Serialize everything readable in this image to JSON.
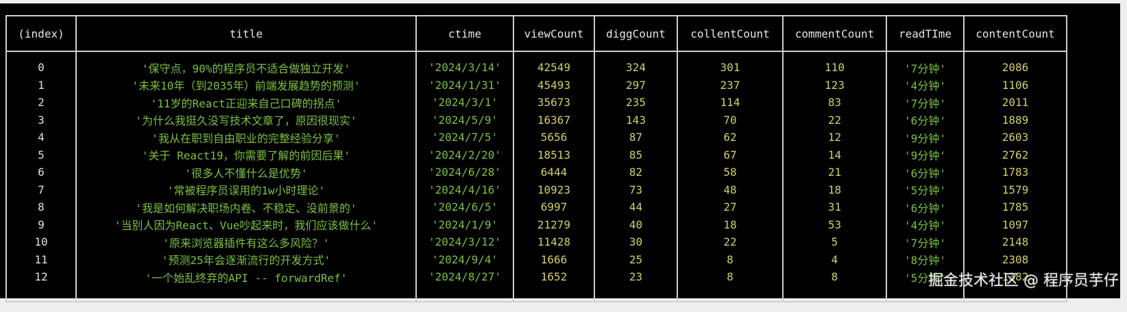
{
  "columns": [
    "(index)",
    "title",
    "ctime",
    "viewCount",
    "diggCount",
    "collentCount",
    "commentCount",
    "readTIme",
    "contentCount"
  ],
  "rows": [
    [
      "0",
      "'保守点，90%的程序员不适合做独立开发'",
      "'2024/3/14'",
      "42549",
      "324",
      "301",
      "110",
      "'7分钟'",
      "2086"
    ],
    [
      "1",
      "'未来10年（到2035年）前端发展趋势的预测'",
      "'2024/1/31'",
      "45493",
      "297",
      "237",
      "123",
      "'4分钟'",
      "1106"
    ],
    [
      "2",
      "'11岁的React正迎来自己口碑的拐点'",
      "'2024/3/1'",
      "35673",
      "235",
      "114",
      "83",
      "'7分钟'",
      "2011"
    ],
    [
      "3",
      "'为什么我挺久没写技术文章了，原因很现实'",
      "'2024/5/9'",
      "16367",
      "143",
      "70",
      "22",
      "'6分钟'",
      "1889"
    ],
    [
      "4",
      "'我从在职到自由职业的完整经验分享'",
      "'2024/7/5'",
      "5656",
      "87",
      "62",
      "12",
      "'9分钟'",
      "2603"
    ],
    [
      "5",
      "'关于 React19，你需要了解的前因后果'",
      "'2024/2/20'",
      "18513",
      "85",
      "67",
      "14",
      "'9分钟'",
      "2762"
    ],
    [
      "6",
      "'很多人不懂什么是优势'",
      "'2024/6/28'",
      "6444",
      "82",
      "58",
      "21",
      "'6分钟'",
      "1783"
    ],
    [
      "7",
      "'常被程序员误用的1w小时理论'",
      "'2024/4/16'",
      "10923",
      "73",
      "48",
      "18",
      "'5分钟'",
      "1579"
    ],
    [
      "8",
      "'我是如何解决职场内卷、不稳定、没前景的'",
      "'2024/6/5'",
      "6997",
      "44",
      "27",
      "31",
      "'6分钟'",
      "1785"
    ],
    [
      "9",
      "'当别人因为React、Vue吵起来时，我们应该做什么'",
      "'2024/1/9'",
      "21279",
      "40",
      "18",
      "53",
      "'4分钟'",
      "1097"
    ],
    [
      "10",
      "'原来浏览器插件有这么多风险？'",
      "'2024/3/12'",
      "11428",
      "30",
      "22",
      "5",
      "'7分钟'",
      "2148"
    ],
    [
      "11",
      "'预测25年会逐渐流行的开发方式'",
      "'2024/9/4'",
      "1666",
      "25",
      "8",
      "4",
      "'8分钟'",
      "2308"
    ],
    [
      "12",
      "'一个始乱终弃的API -- forwardRef'",
      "'2024/8/27'",
      "1652",
      "23",
      "8",
      "8",
      "'5分钟'",
      "1382"
    ]
  ],
  "watermark": "掘金技术社区 @ 程序员芋仔"
}
